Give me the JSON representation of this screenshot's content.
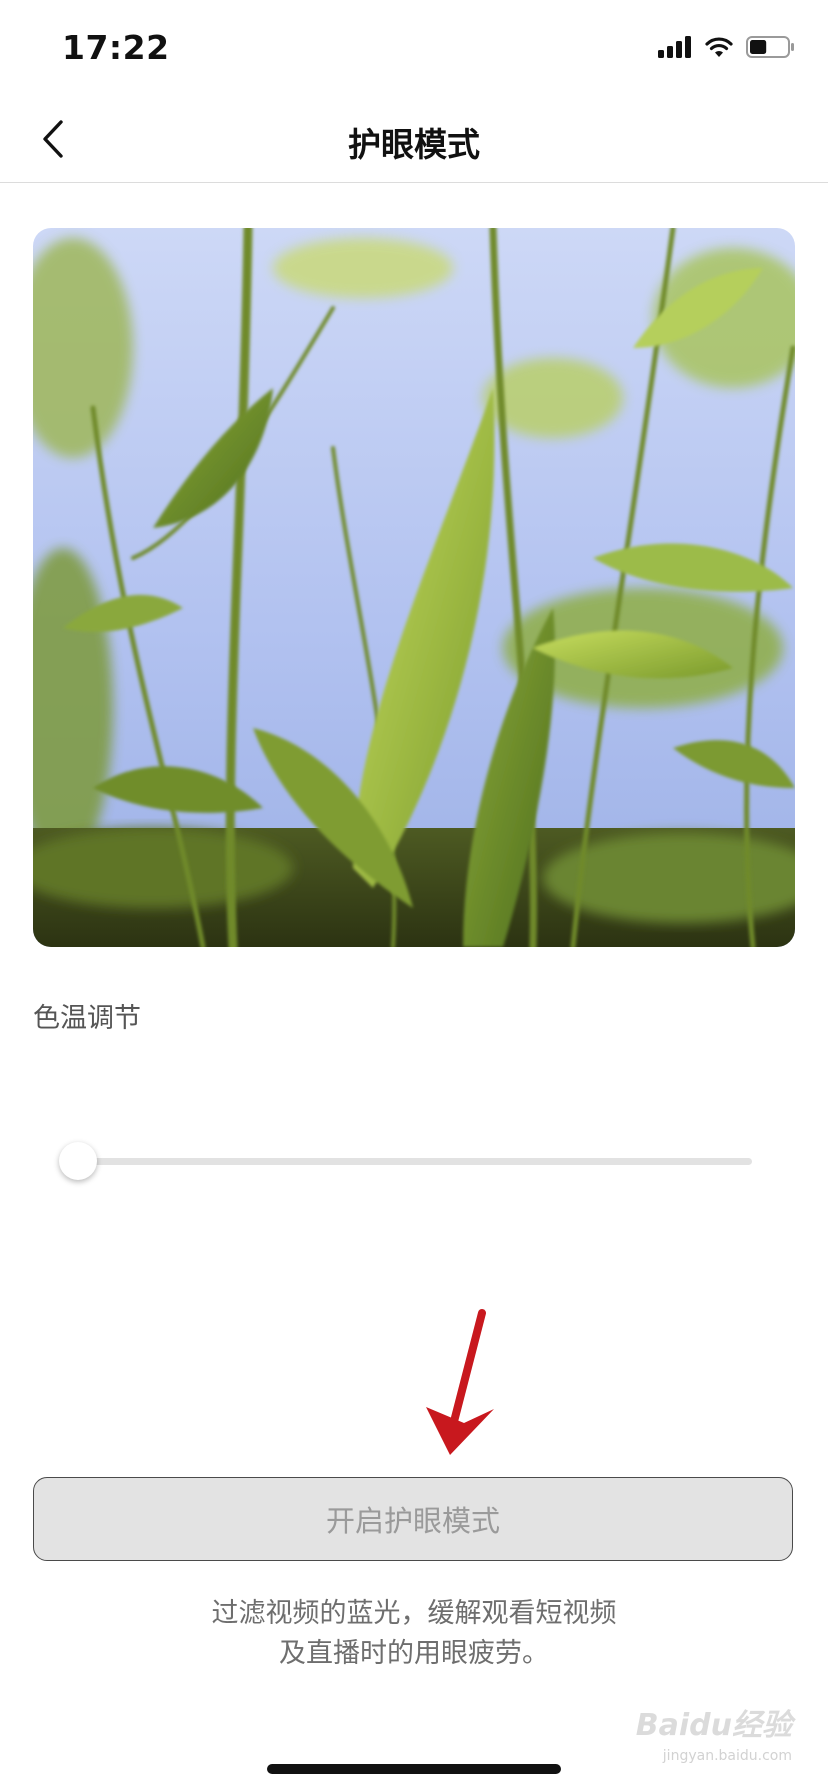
{
  "status_bar": {
    "time": "17:22",
    "icons": [
      "signal-icon",
      "wifi-icon",
      "battery-icon"
    ],
    "battery_level": 0.45
  },
  "nav": {
    "back_icon": "chevron-left-icon",
    "title": "护眼模式"
  },
  "preview": {
    "icon": "bamboo-leaves-photo"
  },
  "color_temperature": {
    "label": "色温调节",
    "value": 0
  },
  "annotation": {
    "icon": "arrow-down-icon",
    "color": "#c8181e"
  },
  "action": {
    "button_label": "开启护眼模式"
  },
  "description": {
    "line1": "过滤视频的蓝光，缓解观看短视频",
    "line2": "及直播时的用眼疲劳。"
  },
  "watermark": {
    "text": "Baidu经验",
    "subtext": "jingyan.baidu.com"
  }
}
